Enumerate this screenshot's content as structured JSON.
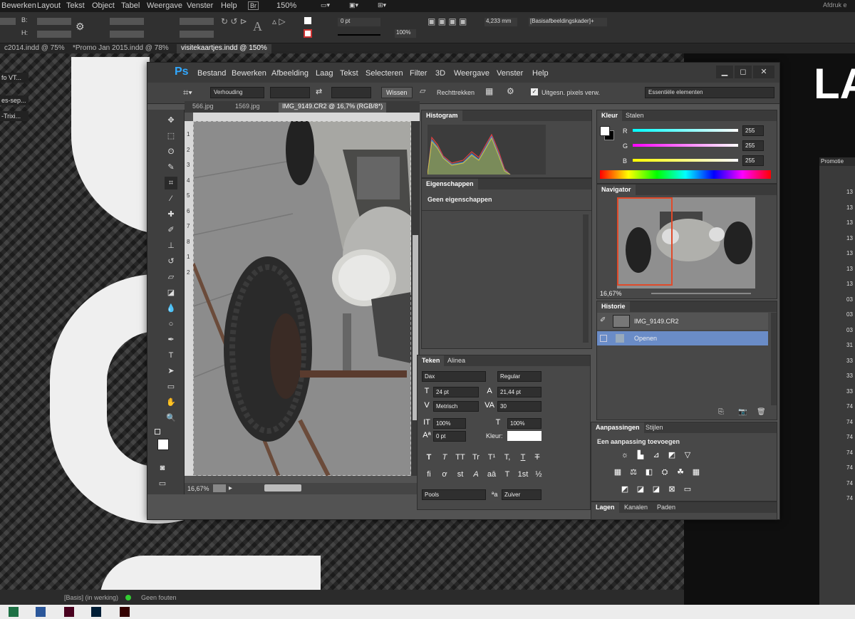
{
  "indesign": {
    "menu": [
      "Bewerken",
      "Layout",
      "Tekst",
      "Object",
      "Tabel",
      "Weergave",
      "Venster",
      "Help"
    ],
    "br_badge": "Br",
    "zoom": "150%",
    "top_right": "Afdruk e",
    "stroke_weight": "0 pt",
    "scale_pct": "100%",
    "dimension": "4,233 mm",
    "frame_style": "[Basisafbeeldingskader]+",
    "tabs": [
      "c2014.indd @ 75%",
      "*Promo Jan 2015.indd @ 78%",
      "visitekaartjes.indd @ 150%"
    ],
    "sidebar": [
      "fo VT...",
      "es-sep...",
      "-Trixi..."
    ],
    "status": {
      "basis": "[Basis] (in werking)",
      "errors": "Geen fouten"
    },
    "right_panel": {
      "title": "Promotie",
      "numbers": [
        "13",
        "13",
        "13",
        "13",
        "13",
        "13",
        "13",
        "03",
        "03",
        "03",
        "31",
        "33",
        "33",
        "33",
        "74",
        "74",
        "74",
        "74",
        "74",
        "74",
        "74"
      ]
    },
    "big_text": "LA"
  },
  "ps": {
    "logo": "Ps",
    "menu": [
      "Bestand",
      "Bewerken",
      "Afbeelding",
      "Laag",
      "Tekst",
      "Selecteren",
      "Filter",
      "3D",
      "Weergave",
      "Venster",
      "Help"
    ],
    "options": {
      "ratio": "Verhouding",
      "clear": "Wissen",
      "straighten": "Rechttrekken",
      "delete_pixels": "Uitgesn. pixels verw.",
      "workspace": "Essentiële elementen"
    },
    "doc_tabs": [
      "566.jpg",
      "1569.jpg",
      "IMG_9149.CR2 @ 16,7% (RGB/8*)"
    ],
    "ruler": [
      "1",
      "2",
      "3",
      "4",
      "5",
      "6",
      "7",
      "8",
      "1",
      "2"
    ],
    "doc_zoom": "16,67%",
    "histogram": {
      "title": "Histogram"
    },
    "properties": {
      "title": "Eigenschappen",
      "text": "Geen eigenschappen"
    },
    "type": {
      "tabs": [
        "Teken",
        "Alinea"
      ],
      "font": "Dax",
      "style": "Regular",
      "size": "24 pt",
      "leading": "21,44 pt",
      "kerning": "Metrisch",
      "tracking": "30",
      "vscale": "100%",
      "hscale": "100%",
      "baseline": "0 pt",
      "color_label": "Kleur:",
      "glyphs": [
        "T",
        "T",
        "TT",
        "Tr",
        "T¹",
        "T,",
        "T",
        "T"
      ],
      "glyphs2": [
        "fi",
        "ơ",
        "st",
        "A",
        "aā",
        "T",
        "1st",
        "½"
      ],
      "lang": "Pools",
      "aa_icon": "ªa",
      "aa": "Zuiver"
    },
    "color": {
      "tabs": [
        "Kleur",
        "Stalen"
      ],
      "r": "255",
      "g": "255",
      "b": "255",
      "r_label": "R",
      "g_label": "G",
      "b_label": "B"
    },
    "navigator": {
      "title": "Navigator",
      "zoom": "16,67%"
    },
    "history": {
      "title": "Historie",
      "items": [
        "IMG_9149.CR2",
        "Openen"
      ]
    },
    "adjustments": {
      "tabs": [
        "Aanpassingen",
        "Stijlen"
      ],
      "text": "Een aanpassing toevoegen"
    },
    "layers": {
      "tabs": [
        "Lagen",
        "Kanalen",
        "Paden"
      ]
    },
    "colors": {
      "ps_blue": "#31a8ff",
      "history_sel": "#6a8cc7"
    }
  }
}
